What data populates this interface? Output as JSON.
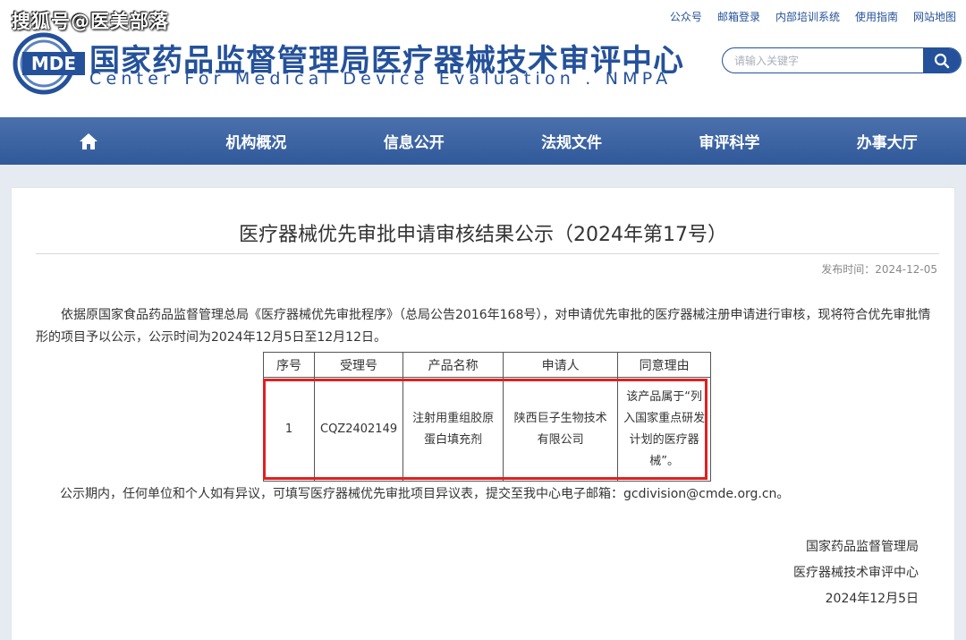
{
  "watermark": "搜狐号@医美部落",
  "logo": {
    "mark_text": "MDE",
    "name_cn": "国家药品监督管理局医疗器械技术审评中心",
    "name_en": "Center For Medical Device Evaluation . NMPA"
  },
  "top_links": [
    "公众号",
    "邮箱登录",
    "内部培训系统",
    "使用指南",
    "网站地图"
  ],
  "search": {
    "placeholder": "请输入关键字"
  },
  "nav": [
    "机构概况",
    "信息公开",
    "法规文件",
    "审评科学",
    "办事大厅"
  ],
  "article": {
    "title": "医疗器械优先审批申请审核结果公示（2024年第17号）",
    "publish_date": "发布时间：2024-12-05",
    "intro": "依据原国家食品药品监督管理总局《医疗器械优先审批程序》（总局公告2016年168号），对申请优先审批的医疗器械注册申请进行审核，现将符合优先审批情形的项目予以公示，公示时间为2024年12月5日至12月12日。",
    "notice": "公示期内，任何单位和个人如有异议，可填写医疗器械优先审批项目异议表，提交至我中心电子邮箱：gcdivision@cmde.org.cn。",
    "table": {
      "headers": [
        "序号",
        "受理号",
        "产品名称",
        "申请人",
        "同意理由"
      ],
      "rows": [
        [
          "1",
          "CQZ2402149",
          "注射用重组胶原蛋白填充剂",
          "陕西巨子生物技术有限公司",
          "该产品属于“列入国家重点研发计划的医疗器械”。"
        ]
      ]
    },
    "signature": {
      "org1": "国家药品监督管理局",
      "org2": "医疗器械技术审评中心",
      "date": "2024年12月5日"
    }
  },
  "colors": {
    "brand": "#24519a",
    "nav": "#3a63a3",
    "highlight": "#e02020"
  }
}
